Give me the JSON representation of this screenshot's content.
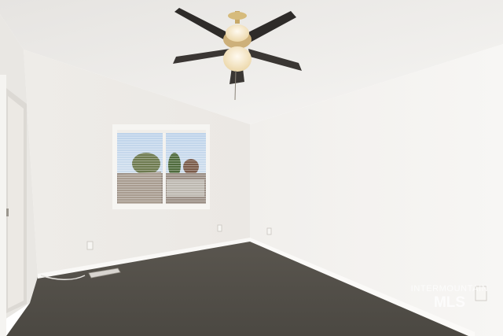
{
  "watermark": {
    "line1": "INTERMOUNTAIN",
    "line2": "MLS"
  },
  "colors": {
    "ceiling": "#f2f1ef",
    "wall_left": "#edebe8",
    "wall_right": "#f4f3f1",
    "wall_far": "#efedea",
    "carpet": "#55514b",
    "trim": "#fafaf8",
    "fan_blade": "#2e2b29",
    "fan_globe": "#f6e6c4"
  },
  "icons": [
    "ceiling-fan-icon",
    "window-blinds-icon",
    "outlet-icon",
    "floor-vent-icon"
  ]
}
